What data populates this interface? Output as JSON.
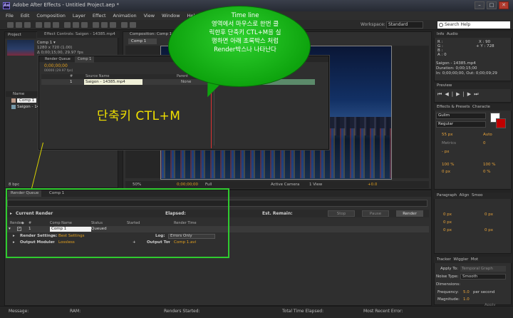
{
  "window": {
    "app_icon": "Ae",
    "title": "Adobe After Effects - Untitled Project.aep *",
    "controls": [
      "–",
      "□",
      "✕"
    ]
  },
  "menu": [
    "File",
    "Edit",
    "Composition",
    "Layer",
    "Effect",
    "Animation",
    "View",
    "Window",
    "Help"
  ],
  "toolbar": {
    "workspace_label": "Workspace:",
    "workspace_value": "Standard",
    "search_placeholder": "Search Help"
  },
  "project": {
    "tab": "Project",
    "effect_controls_tab": "Effect Controls: Saigon - 14385.mp4",
    "comp_name": "Comp 1 ▾",
    "comp_size": "1280 x 720 (1.00)",
    "comp_duration": "Δ 0;00;15;00, 29.97 fps",
    "col_name": "Name",
    "items": [
      "Comp 1",
      "Saigon - 14385.mp4"
    ],
    "bpc": "8 bpc"
  },
  "composition": {
    "tab": "Composition: Comp 1",
    "comp_label": "Comp 1",
    "zoom": "50%",
    "timecode": "0;00;00;00",
    "resolution": "Full",
    "camera": "Active Camera",
    "views": "1 View",
    "offset": "+0.0"
  },
  "timeline": {
    "tabs": [
      "Render Queue",
      "Comp 1"
    ],
    "timecode": "0;00;00;00",
    "fps_info": "00000 (29.97 fps)",
    "columns": [
      "#",
      "Source Name",
      "Parent"
    ],
    "layer_index": "1",
    "layer_name": "Saigon - 14385.mp4",
    "parent_value": "None"
  },
  "annotation": {
    "callout_text": "Time line\n영역에서 마우스로 한번 클\n릭한후 단축키 CTL+M을 실\n행하면 아래 초록박스 처럼\nRender박스나 나타난다",
    "shortcut_text": "단축키 CTL+M"
  },
  "info": {
    "tabs": [
      "Info",
      "Audio"
    ],
    "r": "R :",
    "g": "G :",
    "b": "B :",
    "a": "A : 0",
    "x": "X : 90",
    "y": "+ Y : 728",
    "file": "Saigon - 14385.mp4",
    "duration": "Duration: 0;00;15;00",
    "in_out": "In: 0;00;00;00, Out: 0;00;09;29"
  },
  "preview": {
    "tab": "Preview",
    "controls": [
      "⏮",
      "◀|",
      "▶",
      "|▶",
      "⏭",
      "🔊",
      "⟳",
      "⏏"
    ]
  },
  "effects": {
    "tabs": [
      "Effects & Presets",
      "Characte"
    ],
    "font": "Gulim",
    "style": "Regular",
    "size": "55 px",
    "leading": "Auto",
    "kerning": "Metrics",
    "tracking": "0",
    "stroke": "- px",
    "vscale": "100 %",
    "hscale": "100 %",
    "baseline": "0 px",
    "tsume": "0 %",
    "colors": {
      "fill": "#ffffff",
      "stroke": "#c00000"
    }
  },
  "paragraph": {
    "tabs": [
      "Paragraph",
      "Align",
      "Smoo"
    ],
    "values": [
      "0 px",
      "0 px",
      "0 px",
      "0 px",
      "0 px"
    ]
  },
  "wiggler": {
    "tabs": [
      "Tracker",
      "Wiggler",
      "Mot"
    ],
    "apply_to_label": "Apply To:",
    "apply_to_value": "Temporal Graph",
    "noise_label": "Noise Type:",
    "noise_value": "Smooth",
    "dimensions_label": "Dimensions:",
    "frequency_label": "Frequency:",
    "frequency_value": "5.0",
    "frequency_unit": "per second",
    "magnitude_label": "Magnitude:",
    "magnitude_value": "1.0",
    "apply_button": "Apply"
  },
  "render_queue": {
    "tabs": [
      "Render Queue",
      "Comp 1"
    ],
    "current_render": "Current Render",
    "elapsed": "Elapsed:",
    "remain": "Est. Remain:",
    "buttons": [
      "Stop",
      "Pause",
      "Render"
    ],
    "columns": [
      "Render",
      "#",
      "Comp Name",
      "Status",
      "Started",
      "Render Time"
    ],
    "row": {
      "index": "1",
      "comp": "Comp 1",
      "status": "Queued"
    },
    "render_settings_label": "Render Settings:",
    "render_settings_value": "Best Settings",
    "log_label": "Log:",
    "log_value": "Errors Only",
    "output_module_label": "Output Module:",
    "output_module_value": "Lossless",
    "output_to_label": "Output To:",
    "output_to_value": "Comp 1.avi"
  },
  "status": {
    "message": "Message:",
    "ram": "RAM:",
    "renders_started": "Renders Started:",
    "total_time": "Total Time Elapsed:",
    "recent_error": "Most Recent Error:"
  }
}
